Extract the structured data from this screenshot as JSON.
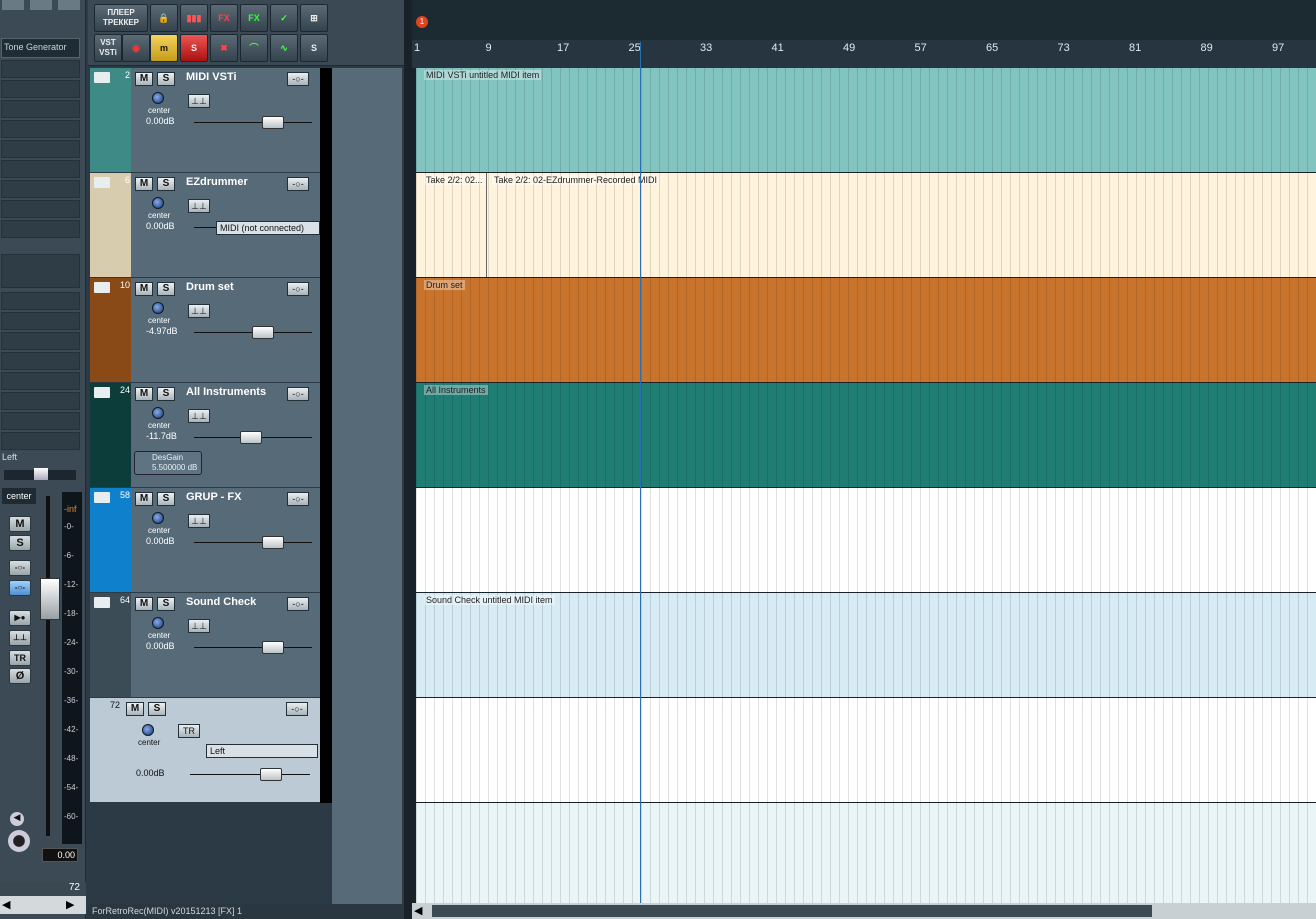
{
  "mixer": {
    "fx_slot": "Tone Generator",
    "route": "Left",
    "pan": "center",
    "meter_top": "-inf",
    "meter_scale": [
      "-0-",
      "-6-",
      "-12-",
      "-18-",
      "-24-",
      "-30-",
      "-36-",
      "-42-",
      "-48-",
      "-54-",
      "-60-"
    ],
    "volume": "0.00",
    "track_number": "72",
    "buttons": {
      "mute": "M",
      "solo": "S",
      "trim": "TR",
      "phase": "Ø"
    }
  },
  "toolbar": {
    "player_label": "ПЛЕЕР\nТРЕККЕР",
    "vsti_label": "VST\nVSTi",
    "fx_label": "FX",
    "m_label": "m",
    "s_label": "S"
  },
  "tracks": [
    {
      "num": "2",
      "name": "MIDI VSTi",
      "pan": "center",
      "vol": "0.00dB",
      "color": "#3d8a86",
      "item": "MIDI VSTi untitled MIDI item"
    },
    {
      "num": "6",
      "name": "EZdrummer",
      "pan": "center",
      "vol": "0.00dB",
      "color": "#d8ccaf",
      "input": "MIDI (not connected)",
      "item": "Take 2/2: 02...",
      "item2": "Take 2/2: 02-EZdrummer-Recorded MIDI"
    },
    {
      "num": "10",
      "name": "Drum set",
      "pan": "center",
      "vol": "-4.97dB",
      "color": "#8a4a17",
      "item": "Drum set"
    },
    {
      "num": "24",
      "name": "All Instruments",
      "pan": "center",
      "vol": "-11.7dB",
      "color": "#0d3d3a",
      "param_name": "DesGain",
      "param_value": "5.500000 dB",
      "thumb": "G",
      "item": "All Instruments"
    },
    {
      "num": "58",
      "name": "GRUP - FX",
      "pan": "center",
      "vol": "0.00dB",
      "color": "#0f80cc",
      "thumb": "FX"
    },
    {
      "num": "64",
      "name": "Sound Check",
      "pan": "center",
      "vol": "0.00dB",
      "color": "#3c4c56",
      "item": "Sound Check untitled MIDI item"
    },
    {
      "num": "72",
      "name": "",
      "pan": "center",
      "vol": "0.00dB",
      "color": "#bccad6",
      "input": "Left"
    }
  ],
  "ruler": {
    "marker": "1",
    "bars": [
      "1",
      "9",
      "17",
      "25",
      "33",
      "41",
      "49",
      "57",
      "65",
      "73",
      "81",
      "89",
      "97"
    ]
  },
  "status": "ForRetroRec(MIDI) v20151213 [FX] 1"
}
